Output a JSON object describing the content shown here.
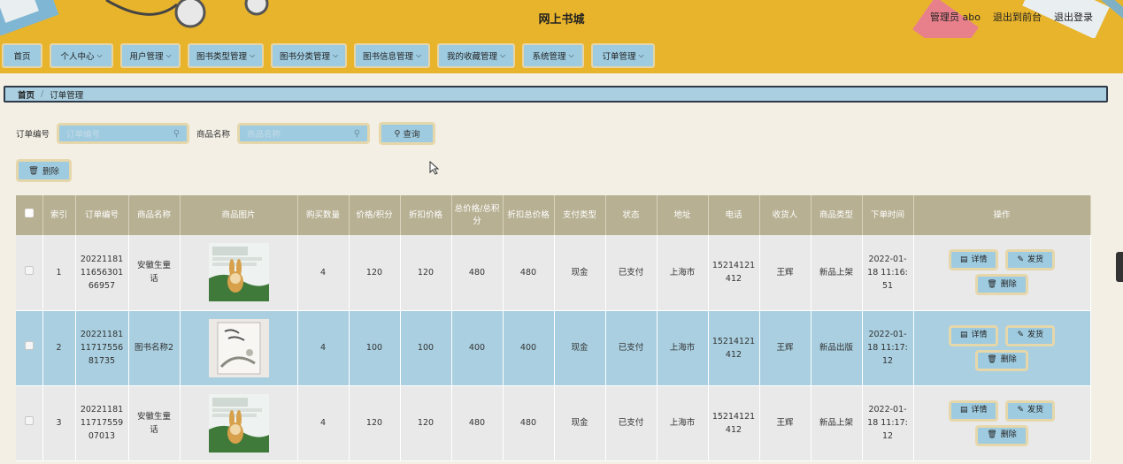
{
  "header": {
    "title": "网上书城",
    "admin": "管理员 abo",
    "front": "退出到前台",
    "logout": "退出登录"
  },
  "nav": [
    {
      "label": "首页",
      "chevron": false
    },
    {
      "label": "个人中心",
      "chevron": true
    },
    {
      "label": "用户管理",
      "chevron": true
    },
    {
      "label": "图书类型管理",
      "chevron": true
    },
    {
      "label": "图书分类管理",
      "chevron": true
    },
    {
      "label": "图书信息管理",
      "chevron": true
    },
    {
      "label": "我的收藏管理",
      "chevron": true
    },
    {
      "label": "系统管理",
      "chevron": true
    },
    {
      "label": "订单管理",
      "chevron": true
    }
  ],
  "breadcrumb": {
    "home": "首页",
    "sep": "/",
    "current": "订单管理"
  },
  "search": {
    "order_label": "订单编号",
    "order_placeholder": "订单编号",
    "name_label": "商品名称",
    "name_placeholder": "商品名称",
    "query": "查询"
  },
  "actions": {
    "delete": "删除"
  },
  "columns": [
    "索引",
    "订单编号",
    "商品名称",
    "商品图片",
    "购买数量",
    "价格/积分",
    "折扣价格",
    "总价格/总积分",
    "折扣总价格",
    "支付类型",
    "状态",
    "地址",
    "电话",
    "收货人",
    "商品类型",
    "下单时间",
    "操作"
  ],
  "row_actions": {
    "detail": "详情",
    "ship": "发货",
    "delete": "删除"
  },
  "rows": [
    {
      "index": "1",
      "order_no": "20221181116563016695 7",
      "order_lines": [
        "20221181",
        "11656301",
        "66957"
      ],
      "name_lines": [
        "安徽生童",
        "话"
      ],
      "image": "rabbit",
      "qty": "4",
      "price": "120",
      "discount_price": "120",
      "total": "480",
      "discount_total": "480",
      "pay": "现金",
      "status": "已支付",
      "address": "上海市",
      "phone_lines": [
        "15214121",
        "412"
      ],
      "receiver": "王辉",
      "type": "新品上架",
      "time_lines": [
        "2022-01-",
        "18 11:16:",
        "51"
      ]
    },
    {
      "index": "2",
      "order_lines": [
        "20221181",
        "11717556",
        "81735"
      ],
      "name_lines": [
        "图书名称2"
      ],
      "image": "book",
      "qty": "4",
      "price": "100",
      "discount_price": "100",
      "total": "400",
      "discount_total": "400",
      "pay": "现金",
      "status": "已支付",
      "address": "上海市",
      "phone_lines": [
        "15214121",
        "412"
      ],
      "receiver": "王辉",
      "type": "新品出版",
      "time_lines": [
        "2022-01-",
        "18 11:17:",
        "12"
      ]
    },
    {
      "index": "3",
      "order_lines": [
        "20221181",
        "11717559",
        "07013"
      ],
      "name_lines": [
        "安徽生童",
        "话"
      ],
      "image": "rabbit",
      "qty": "4",
      "price": "120",
      "discount_price": "120",
      "total": "480",
      "discount_total": "480",
      "pay": "现金",
      "status": "已支付",
      "address": "上海市",
      "phone_lines": [
        "15214121",
        "412"
      ],
      "receiver": "王辉",
      "type": "新品上架",
      "time_lines": [
        "2022-01-",
        "18 11:17:",
        "12"
      ]
    }
  ]
}
